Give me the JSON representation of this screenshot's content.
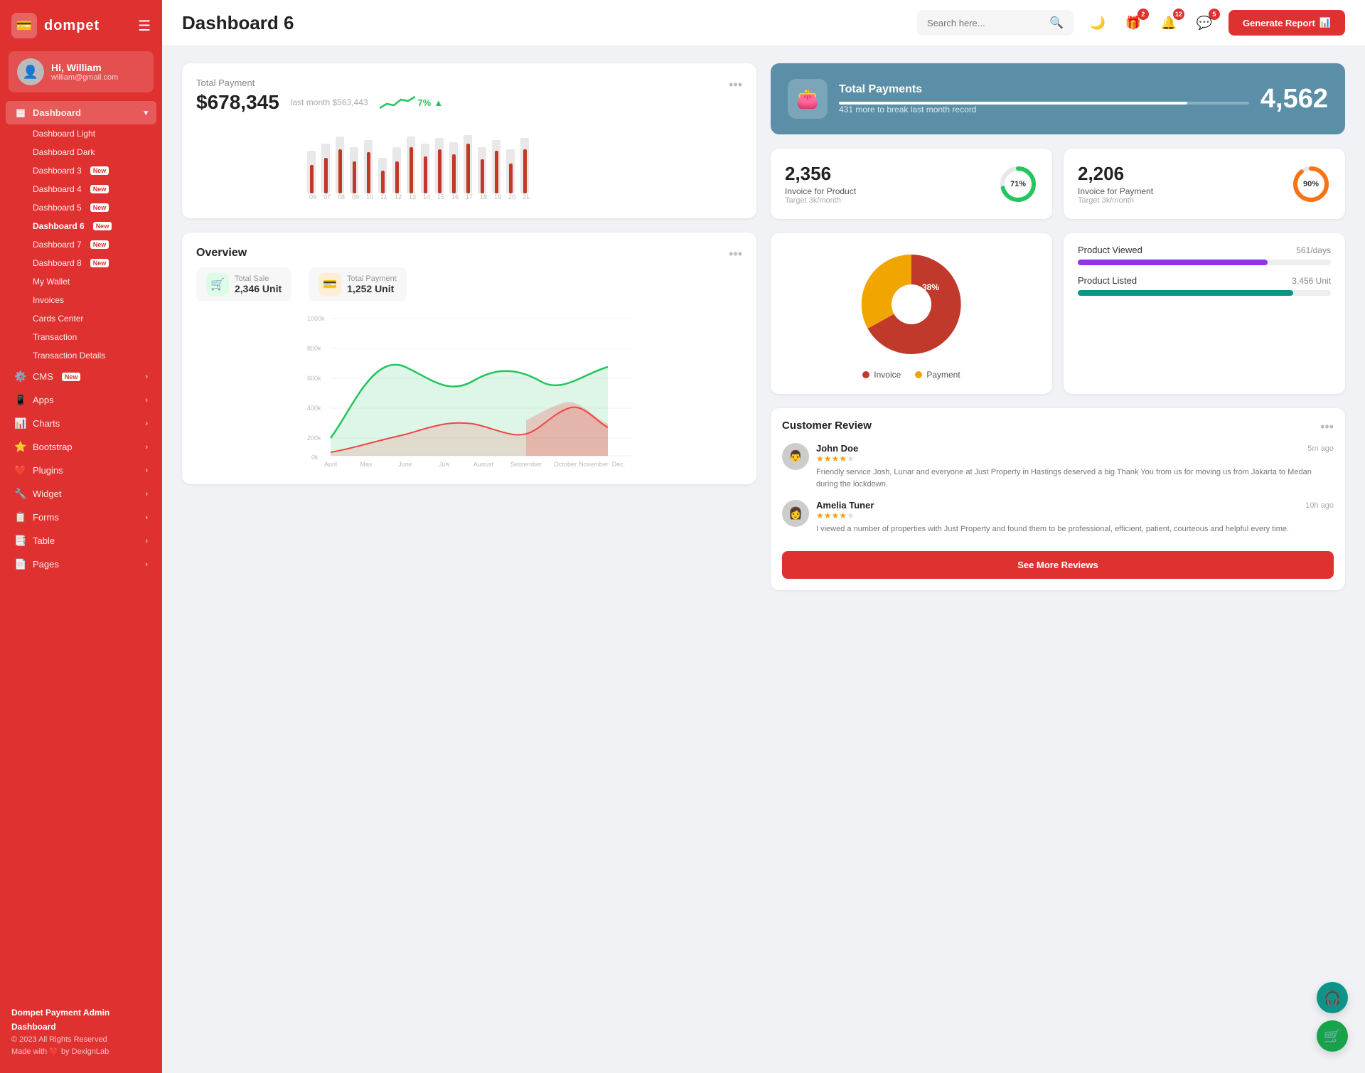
{
  "sidebar": {
    "logo": "dompet",
    "logo_icon": "💳",
    "hamburger": "☰",
    "user": {
      "greeting": "Hi, William",
      "name": "William",
      "email": "william@gmail.com",
      "avatar": "👤"
    },
    "nav": {
      "dashboard_label": "Dashboard",
      "items": [
        {
          "label": "Dashboard Light",
          "active": false,
          "badge": "",
          "indent": true
        },
        {
          "label": "Dashboard Dark",
          "active": false,
          "badge": "",
          "indent": true
        },
        {
          "label": "Dashboard 3",
          "active": false,
          "badge": "New",
          "indent": true
        },
        {
          "label": "Dashboard 4",
          "active": false,
          "badge": "New",
          "indent": true
        },
        {
          "label": "Dashboard 5",
          "active": false,
          "badge": "New",
          "indent": true
        },
        {
          "label": "Dashboard 6",
          "active": true,
          "badge": "New",
          "indent": true
        },
        {
          "label": "Dashboard 7",
          "active": false,
          "badge": "New",
          "indent": true
        },
        {
          "label": "Dashboard 8",
          "active": false,
          "badge": "New",
          "indent": true
        },
        {
          "label": "My Wallet",
          "active": false,
          "badge": "",
          "indent": true
        },
        {
          "label": "Invoices",
          "active": false,
          "badge": "",
          "indent": true
        },
        {
          "label": "Cards Center",
          "active": false,
          "badge": "",
          "indent": true
        },
        {
          "label": "Transaction",
          "active": false,
          "badge": "",
          "indent": true
        },
        {
          "label": "Transaction Details",
          "active": false,
          "badge": "",
          "indent": true
        }
      ],
      "main_items": [
        {
          "label": "CMS",
          "icon": "⚙️",
          "badge": "New",
          "has_arrow": true
        },
        {
          "label": "Apps",
          "icon": "📱",
          "badge": "",
          "has_arrow": true
        },
        {
          "label": "Charts",
          "icon": "📊",
          "badge": "",
          "has_arrow": true
        },
        {
          "label": "Bootstrap",
          "icon": "⭐",
          "badge": "",
          "has_arrow": true
        },
        {
          "label": "Plugins",
          "icon": "❤️",
          "badge": "",
          "has_arrow": true
        },
        {
          "label": "Widget",
          "icon": "🔧",
          "badge": "",
          "has_arrow": true
        },
        {
          "label": "Forms",
          "icon": "📋",
          "badge": "",
          "has_arrow": true
        },
        {
          "label": "Table",
          "icon": "📑",
          "badge": "",
          "has_arrow": true
        },
        {
          "label": "Pages",
          "icon": "📄",
          "badge": "",
          "has_arrow": true
        }
      ]
    },
    "footer": {
      "brand": "Dompet Payment Admin Dashboard",
      "copyright": "© 2023 All Rights Reserved",
      "made_with": "Made with ❤️ by DexignLab"
    }
  },
  "header": {
    "title": "Dashboard 6",
    "search_placeholder": "Search here...",
    "icons": [
      {
        "name": "moon-icon",
        "symbol": "🌙",
        "badge": null
      },
      {
        "name": "gift-icon",
        "symbol": "🎁",
        "badge": "2"
      },
      {
        "name": "bell-icon",
        "symbol": "🔔",
        "badge": "12"
      },
      {
        "name": "chat-icon",
        "symbol": "💬",
        "badge": "5"
      }
    ],
    "generate_btn": "Generate Report"
  },
  "total_payment": {
    "title": "Total Payment",
    "value": "$678,345",
    "last_month": "last month $563,443",
    "trend_pct": "7%",
    "trend_up": true,
    "bars": [
      {
        "gray": 60,
        "red": 30
      },
      {
        "gray": 55,
        "red": 45
      },
      {
        "gray": 70,
        "red": 60
      },
      {
        "gray": 50,
        "red": 40
      },
      {
        "gray": 65,
        "red": 55
      },
      {
        "gray": 45,
        "red": 35
      },
      {
        "gray": 55,
        "red": 50
      },
      {
        "gray": 70,
        "red": 65
      },
      {
        "gray": 50,
        "red": 42
      },
      {
        "gray": 60,
        "red": 55
      },
      {
        "gray": 65,
        "red": 60
      },
      {
        "gray": 55,
        "red": 50
      },
      {
        "gray": 70,
        "red": 65
      },
      {
        "gray": 50,
        "red": 45
      },
      {
        "gray": 60,
        "red": 55
      }
    ],
    "bar_labels": [
      "06",
      "07",
      "08",
      "09",
      "10",
      "11",
      "12",
      "13",
      "14",
      "15",
      "16",
      "17",
      "18",
      "19",
      "20",
      "21"
    ]
  },
  "total_payments_card": {
    "icon": "👛",
    "label": "Total Payments",
    "sub": "431 more to break last month record",
    "value": "4,562",
    "progress": 85
  },
  "invoice_product": {
    "value": "2,356",
    "label": "Invoice for Product",
    "target": "Target 3k/month",
    "pct": 71,
    "color": "#22c55e"
  },
  "invoice_payment": {
    "value": "2,206",
    "label": "Invoice for Payment",
    "target": "Target 3k/month",
    "pct": 90,
    "color": "#f97316"
  },
  "overview": {
    "title": "Overview",
    "total_sale_label": "Total Sale",
    "total_sale_value": "2,346 Unit",
    "total_payment_label": "Total Payment",
    "total_payment_value": "1,252 Unit",
    "months": [
      "April",
      "May",
      "June",
      "July",
      "August",
      "September",
      "October",
      "November",
      "Dec."
    ],
    "y_labels": [
      "0k",
      "200k",
      "400k",
      "600k",
      "800k",
      "1000k"
    ]
  },
  "pie_chart": {
    "invoice_pct": 62,
    "payment_pct": 38,
    "invoice_color": "#c0392b",
    "payment_color": "#f0a500",
    "legend_invoice": "Invoice",
    "legend_payment": "Payment"
  },
  "product_viewed": {
    "label": "Product Viewed",
    "value": "561/days",
    "color": "#9333ea",
    "progress": 75
  },
  "product_listed": {
    "label": "Product Listed",
    "value": "3,456 Unit",
    "color": "#0d9488",
    "progress": 85
  },
  "customer_review": {
    "title": "Customer Review",
    "see_more": "See More Reviews",
    "reviews": [
      {
        "name": "John Doe",
        "time": "5m ago",
        "stars": 4,
        "text": "Friendly service Josh, Lunar and everyone at Just Property in Hastings deserved a big Thank You from us for moving us from Jakarta to Medan during the lockdown.",
        "avatar": "👨"
      },
      {
        "name": "Amelia Tuner",
        "time": "10h ago",
        "stars": 4,
        "text": "I viewed a number of properties with Just Property and found them to be professional, efficient, patient, courteous and helpful every time.",
        "avatar": "👩"
      }
    ]
  },
  "floating": {
    "support": "🎧",
    "cart": "🛒"
  }
}
